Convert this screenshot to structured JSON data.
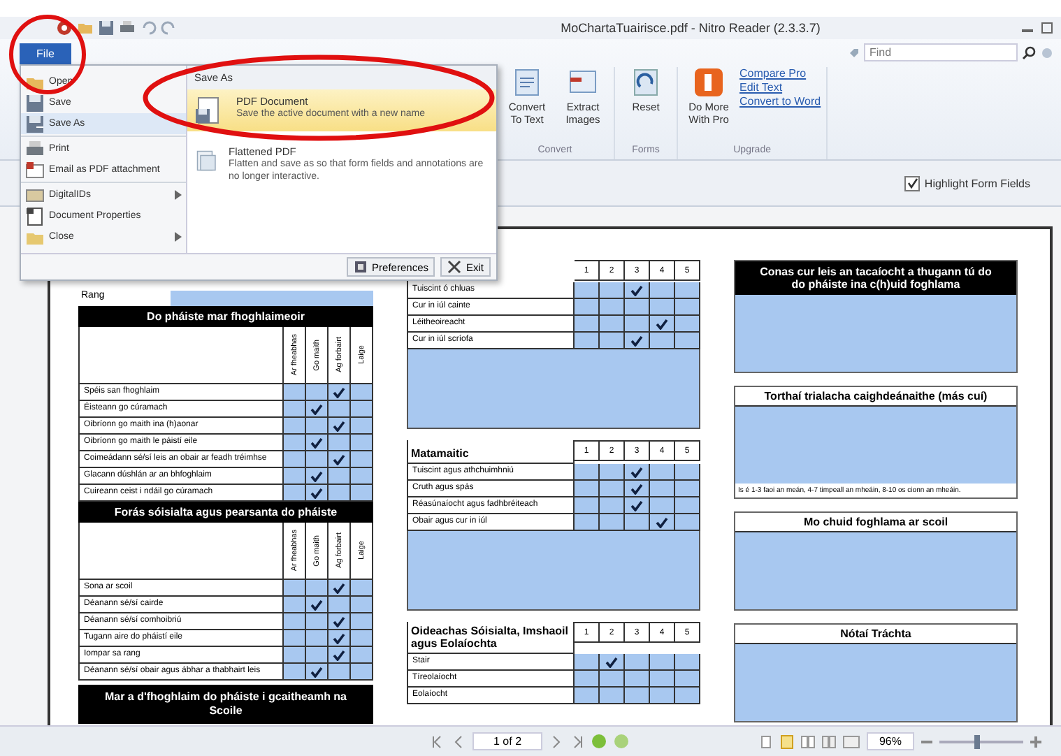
{
  "window": {
    "title": "MoChartaTuairisce.pdf - Nitro Reader (2.3.3.7)"
  },
  "search": {
    "placeholder": "Find"
  },
  "ribbon": {
    "groups": [
      {
        "label": "Convert",
        "buttons": [
          "Convert To Text",
          "Extract Images"
        ]
      },
      {
        "label": "Forms",
        "buttons": [
          "Reset"
        ]
      },
      {
        "label": "Upgrade",
        "buttons": [
          "Do More With Pro"
        ],
        "links": [
          "Compare Pro",
          "Edit Text",
          "Convert to Word"
        ]
      }
    ]
  },
  "form_bar": {
    "highlight": {
      "label": "Highlight Form Fields",
      "checked": true
    }
  },
  "file_menu": {
    "button": "File",
    "items": [
      {
        "label": "Open",
        "submenu": false,
        "selected": false
      },
      {
        "label": "Save",
        "submenu": false,
        "selected": false
      },
      {
        "label": "Save As",
        "submenu": false,
        "selected": true
      },
      {
        "label": "Print",
        "submenu": false,
        "selected": false
      },
      {
        "label": "Email as PDF attachment",
        "submenu": false,
        "selected": false
      },
      {
        "label": "DigitalIDs",
        "submenu": true,
        "selected": false
      },
      {
        "label": "Document Properties",
        "submenu": false,
        "selected": false
      },
      {
        "label": "Close",
        "submenu": true,
        "selected": false
      }
    ],
    "panel": {
      "title": "Save As",
      "options": [
        {
          "title": "PDF Document",
          "description": "Save the active document with a new name",
          "selected": true
        },
        {
          "title": "Flattened PDF",
          "description": "Flatten and save as so that form fields and annotations are no longer interactive.",
          "selected": false
        }
      ]
    },
    "footer_buttons": [
      "Preferences",
      "Exit"
    ]
  },
  "document": {
    "left": {
      "class_label": "Rang",
      "sections": [
        {
          "title": "Do pháiste mar fhoghlaimeoir",
          "column_headers": [
            "Ar fheabhas",
            "Go maith",
            "Ag forbairt",
            "Laige"
          ],
          "rows": [
            {
              "label": "Spéis san fhoghlaim",
              "checks": [
                false,
                false,
                true,
                false
              ]
            },
            {
              "label": "Éisteann go cúramach",
              "checks": [
                false,
                true,
                false,
                false
              ]
            },
            {
              "label": "Oibríonn go maith ina (h)aonar",
              "checks": [
                false,
                false,
                true,
                false
              ]
            },
            {
              "label": "Oibríonn go maith le páistí eile",
              "checks": [
                false,
                true,
                false,
                false
              ]
            },
            {
              "label": "Coimeádann sé/sí leis an obair ar feadh tréimhse",
              "checks": [
                false,
                false,
                true,
                false
              ]
            },
            {
              "label": "Glacann dúshlán ar an bhfoghlaim",
              "checks": [
                false,
                true,
                false,
                false
              ]
            },
            {
              "label": "Cuireann ceist i ndáil go cúramach",
              "checks": [
                false,
                true,
                false,
                false
              ]
            }
          ]
        },
        {
          "title": "Forás sóisialta agus pearsanta do pháiste",
          "column_headers": [
            "Ar fheabhas",
            "Go maith",
            "Ag forbairt",
            "Laige"
          ],
          "rows": [
            {
              "label": "Sona ar scoil",
              "checks": [
                false,
                false,
                true,
                false
              ]
            },
            {
              "label": "Déanann sé/sí cairde",
              "checks": [
                false,
                true,
                false,
                false
              ]
            },
            {
              "label": "Déanann sé/sí comhoibriú",
              "checks": [
                false,
                false,
                true,
                false
              ]
            },
            {
              "label": "Tugann aire do pháistí eile",
              "checks": [
                false,
                false,
                true,
                false
              ]
            },
            {
              "label": "Iompar sa rang",
              "checks": [
                false,
                false,
                true,
                false
              ]
            },
            {
              "label": "Déanann sé/sí obair agus ábhar a thabhairt leis",
              "checks": [
                false,
                true,
                false,
                false
              ]
            }
          ]
        }
      ],
      "footer_title": "Mar a d'fhoghlaim do pháiste i gcaitheamh na Scoile"
    },
    "middle": {
      "tables": [
        {
          "scale": [
            "1",
            "2",
            "3",
            "4",
            "5"
          ],
          "rows": [
            {
              "label": "Tuiscint ó chluas",
              "checks": [
                false,
                false,
                true,
                false,
                false
              ]
            },
            {
              "label": "Cur in iúl cainte",
              "checks": [
                false,
                false,
                false,
                false,
                false
              ]
            },
            {
              "label": "Léitheoireacht",
              "checks": [
                false,
                false,
                false,
                true,
                false
              ]
            },
            {
              "label": "Cur in iúl scríofa",
              "checks": [
                false,
                false,
                true,
                false,
                false
              ]
            }
          ],
          "comment_box": true
        },
        {
          "title": "Matamaitic",
          "scale": [
            "1",
            "2",
            "3",
            "4",
            "5"
          ],
          "rows": [
            {
              "label": "Tuiscint agus athchuimhniú",
              "checks": [
                false,
                false,
                true,
                false,
                false
              ]
            },
            {
              "label": "Cruth agus spás",
              "checks": [
                false,
                false,
                true,
                false,
                false
              ]
            },
            {
              "label": "Réasúnaíocht agus fadhbréiteach",
              "checks": [
                false,
                false,
                true,
                false,
                false
              ]
            },
            {
              "label": "Obair agus cur in iúl",
              "checks": [
                false,
                false,
                false,
                true,
                false
              ]
            }
          ],
          "comment_box": true
        },
        {
          "title": "Oideachas Sóisialta, Imshaoil agus Eolaíochta",
          "scale": [
            "1",
            "2",
            "3",
            "4",
            "5"
          ],
          "rows": [
            {
              "label": "Stair",
              "checks": [
                false,
                true,
                false,
                false,
                false
              ]
            },
            {
              "label": "Tíreolaíocht",
              "checks": [
                false,
                false,
                false,
                false,
                false
              ]
            },
            {
              "label": "Eolaíocht",
              "checks": [
                false,
                false,
                false,
                false,
                false
              ]
            }
          ],
          "comment_box": false
        }
      ]
    },
    "right": {
      "boxes": [
        {
          "kind": "dark",
          "title": "Conas cur leis an tacaíocht a thugann tú do do pháiste ina c(h)uid foghlama"
        },
        {
          "kind": "light",
          "title": "Torthaí trialacha caighdeánaithe (más cuí)",
          "note": "Is é 1-3 faoi an meán, 4-7 timpeall an mheáin, 8-10 os cionn an mheáin."
        },
        {
          "kind": "light",
          "title": "Mo chuid foghlama ar scoil"
        },
        {
          "kind": "light",
          "title": "Nótaí Tráchta"
        }
      ]
    }
  },
  "status_bar": {
    "page": "1 of 2",
    "zoom": "96%",
    "zoom_slider": {
      "level": 0.45
    }
  }
}
